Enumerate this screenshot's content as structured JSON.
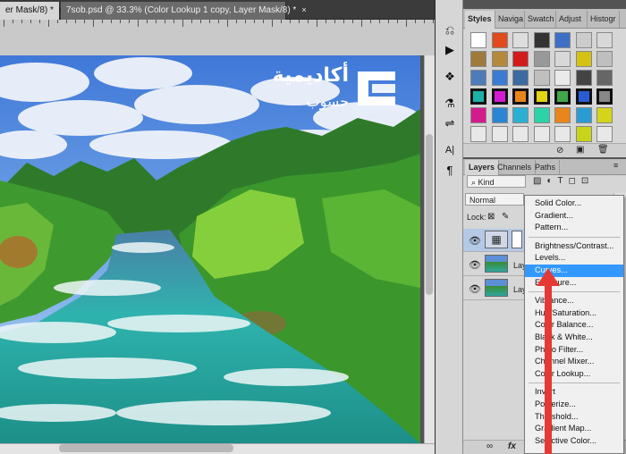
{
  "document": {
    "tabs": [
      {
        "label": "er Mask/8) *",
        "close": "×"
      },
      {
        "label": "7sob.psd @ 33.3% (Color Lookup 1 copy, Layer Mask/8) *",
        "close": "×"
      }
    ],
    "watermark": {
      "arabic_top": "أكاديمية",
      "arabic_bottom": "حسوب"
    }
  },
  "tools": {
    "icons": [
      "history-brush-icon",
      "play-icon",
      "paragraph-doc-icon",
      "adjust-tool-icon",
      "align-tool-icon",
      "text-tool-icon",
      "paragraph-icon"
    ],
    "glyphs": [
      "⎌",
      "▶",
      "❖",
      "⚗",
      "⇌",
      "A|",
      "¶"
    ]
  },
  "styles_panel": {
    "tabs": [
      "Styles",
      "Naviga",
      "Swatch",
      "Adjust",
      "Histogr"
    ],
    "swatch_colors": [
      "#ffffff",
      "#e04a1c",
      "#dddddd",
      "#333333",
      "#3e6fc6",
      "#cccccc",
      "#d8d8d8",
      "#9e7b3c",
      "#b5893c",
      "#d21b1b",
      "#999999",
      "#d8d8d8",
      "#d3c214",
      "#bfbfbf",
      "#4f7bb8",
      "#3b7bd4",
      "#3c6ba0",
      "#bfbfbf",
      "#eaeaea",
      "#444444",
      "#666666",
      "#1bb0a8",
      "#d41bd4",
      "#e8851b",
      "#e0d414",
      "#41a84a",
      "#2b5bd4",
      "#888888",
      "#d41b8c",
      "#2b85d4",
      "#2bb0d4",
      "#2bd4a8",
      "#e8851b",
      "#2b9bd4",
      "#d4d41b",
      "#e8e8e8",
      "#e8e8e8",
      "#e8e8e8",
      "#e8e8e8",
      "#e8e8e8",
      "#c8d41b",
      "#e8e8e8"
    ]
  },
  "layers_panel": {
    "tabs": [
      "Layers",
      "Channels",
      "Paths"
    ],
    "filter_kind": "Kind",
    "blend_mode": "Normal",
    "lock_label": "Lock:",
    "layers": [
      {
        "label": "",
        "type": "adjustment"
      },
      {
        "label": "Lay",
        "type": "photo"
      },
      {
        "label": "Lay",
        "type": "photo"
      }
    ],
    "bottom_icons": [
      "link-icon",
      "fx-icon"
    ],
    "bottom_glyphs": [
      "∞",
      "fx"
    ]
  },
  "adjustment_menu": {
    "groups": [
      [
        "Solid Color...",
        "Gradient...",
        "Pattern..."
      ],
      [
        "Brightness/Contrast...",
        "Levels...",
        "Curves...",
        "Exposure..."
      ],
      [
        "Vibrance...",
        "Hue/Saturation...",
        "Color Balance...",
        "Black & White...",
        "Photo Filter...",
        "Channel Mixer...",
        "Color Lookup..."
      ],
      [
        "Invert",
        "Posterize...",
        "Threshold...",
        "Gradient Map...",
        "Selective Color..."
      ]
    ],
    "highlighted": "Curves..."
  },
  "colors": {
    "menu_highlight": "#3399ff",
    "arrow": "#e53935",
    "panel_bg": "#d6d6d6"
  }
}
